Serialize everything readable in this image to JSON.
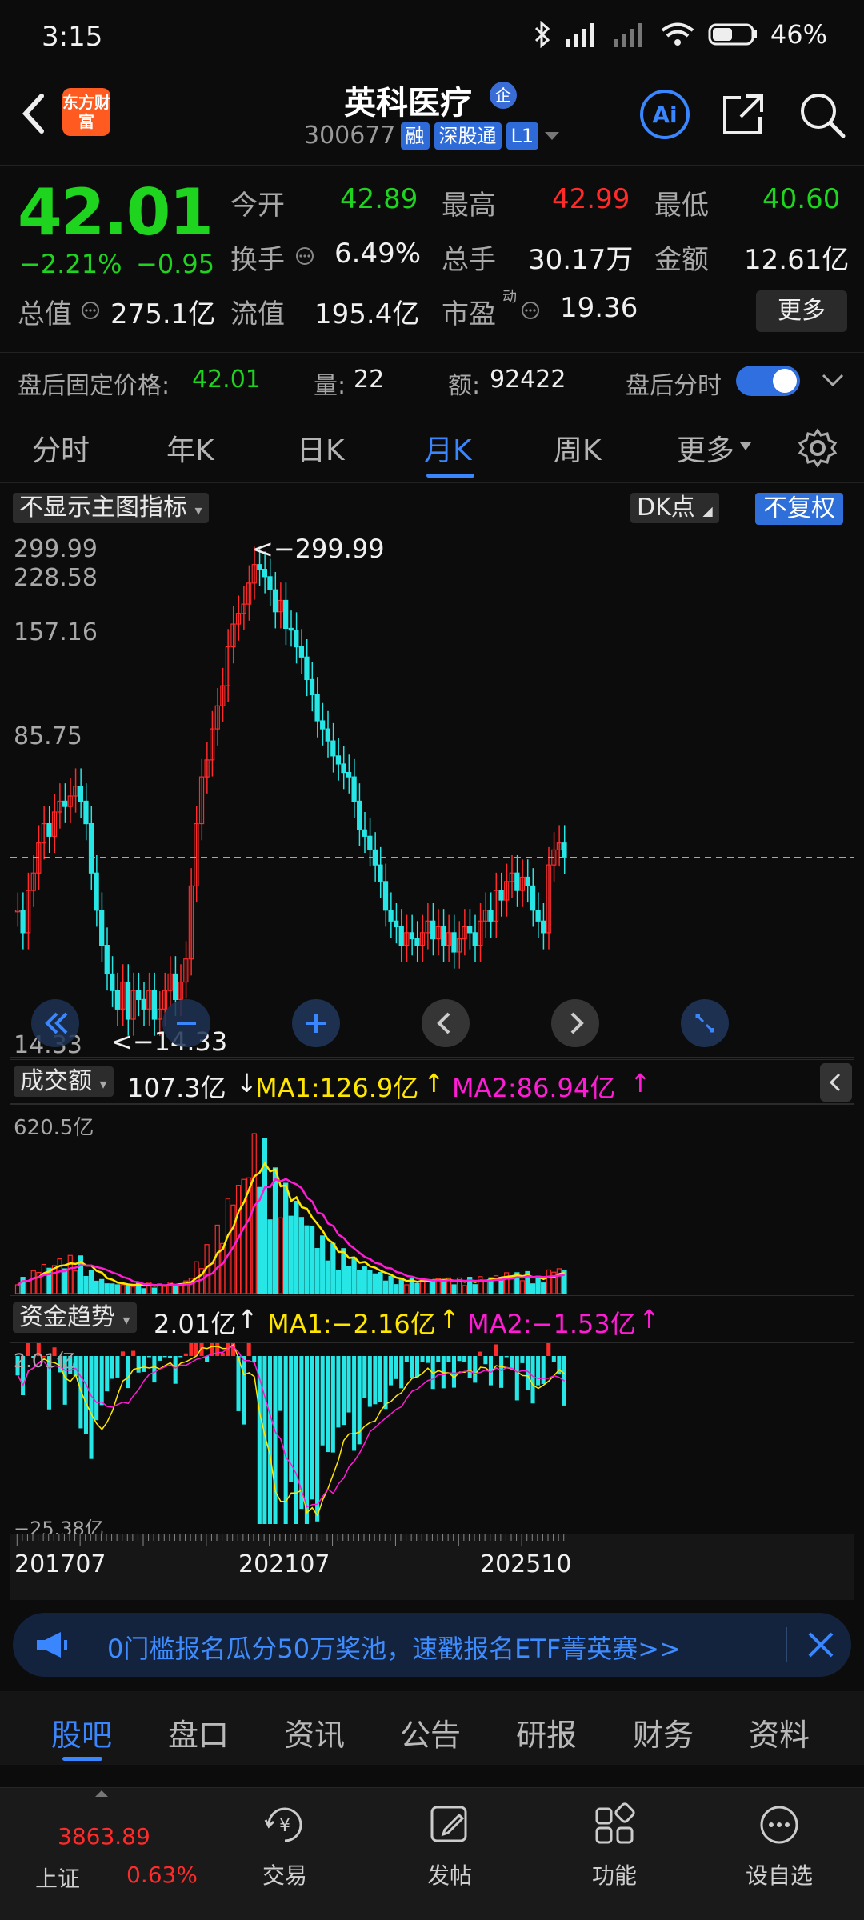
{
  "status_bar": {
    "time": "3:15",
    "battery_percent": "46%"
  },
  "header": {
    "logo_text": "东方财富",
    "stock_name": "英科医疗",
    "qi_badge": "企",
    "stock_code": "300677",
    "tag_rong": "融",
    "tag_connect": "深股通",
    "tag_level": "L1"
  },
  "quote": {
    "price": "42.01",
    "change_pct": "−2.21%",
    "change_abs": "−0.95",
    "open_label": "今开",
    "open_value": "42.89",
    "high_label": "最高",
    "high_value": "42.99",
    "low_label": "最低",
    "low_value": "40.60",
    "turnover_label": "换手",
    "turnover_value": "6.49%",
    "volume_label": "总手",
    "volume_value": "30.17万",
    "amount_label": "金额",
    "amount_value": "12.61亿",
    "mcap_label": "总值",
    "mcap_value": "275.1亿",
    "float_label": "流值",
    "float_value": "195.4亿",
    "pe_label": "市盈",
    "pe_sup": "动",
    "pe_value": "19.36",
    "more_button": "更多"
  },
  "after_hours": {
    "label": "盘后固定价格:",
    "price": "42.01",
    "vol_label": "量:",
    "vol_value": "22",
    "amt_label": "额:",
    "amt_value": "92422",
    "timeshare_label": "盘后分时",
    "toggle_on": true
  },
  "chart_tabs": [
    {
      "label": "分时",
      "active": false
    },
    {
      "label": "年K",
      "active": false
    },
    {
      "label": "日K",
      "active": false
    },
    {
      "label": "月K",
      "active": true
    },
    {
      "label": "周K",
      "active": false
    },
    {
      "label": "更多",
      "active": false
    }
  ],
  "indicator_bar": {
    "main_indicator": "不显示主图指标",
    "dk_label": "DK点",
    "adjust_label": "不复权"
  },
  "chart_data": [
    {
      "type": "candlestick",
      "period": "monthly",
      "y_ticks": [
        "299.99",
        "228.58",
        "157.16",
        "85.75",
        "14.33"
      ],
      "ylim": [
        14.33,
        299.99
      ],
      "max_annotation": "<−299.99",
      "min_annotation": "<−14.33",
      "current_price_line": 42.01,
      "x_ticks": [
        "201707",
        "202107",
        "202510"
      ]
    },
    {
      "type": "bar",
      "indicator": "成交额",
      "value": "107.3亿",
      "arrow": "↓",
      "ma1_label": "MA1:126.9亿",
      "ma1_arrow": "↑",
      "ma2_label": "MA2:86.94亿",
      "ma2_arrow": "↑",
      "y_max_label": "620.5亿"
    },
    {
      "type": "bar",
      "indicator": "资金趋势",
      "value": "2.01亿",
      "arrow": "↑",
      "ma1_label": "MA1:−2.16亿",
      "ma1_arrow": "↑",
      "ma2_label": "MA2:−1.53亿",
      "ma2_arrow": "↑",
      "y_max_label": "2.01亿",
      "y_min_label": "−25.38亿"
    }
  ],
  "banner": {
    "text": "0门槛报名瓜分50万奖池，速戳报名ETF菁英赛>>"
  },
  "bottom_tabs": [
    {
      "label": "股吧",
      "active": true
    },
    {
      "label": "盘口",
      "active": false
    },
    {
      "label": "资讯",
      "active": false
    },
    {
      "label": "公告",
      "active": false
    },
    {
      "label": "研报",
      "active": false
    },
    {
      "label": "财务",
      "active": false
    },
    {
      "label": "资料",
      "active": false
    }
  ],
  "bottom_nav": {
    "index_value": "3863.89",
    "index_name": "上证",
    "index_change": "0.63%",
    "trade": "交易",
    "post": "发帖",
    "functions": "功能",
    "watchlist": "设自选"
  },
  "colors": {
    "up": "#ff2a2a",
    "down": "#1fd41f",
    "accent": "#3a86ff",
    "ma1": "#ffe600",
    "ma2": "#ff1cd4",
    "bar_down": "#26e6e6"
  }
}
